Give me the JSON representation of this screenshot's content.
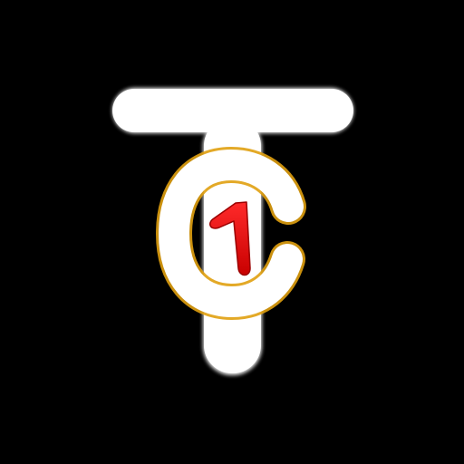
{
  "icon": {
    "name": "tc1-app-icon",
    "letters": {
      "t": "T",
      "c": "C",
      "digit": "1"
    },
    "colors": {
      "background": "#000000",
      "t_fill": "#ffffff",
      "c_fill": "#ffffff",
      "c_outline": "#e0a010",
      "digit_fill": "#e00000"
    }
  }
}
